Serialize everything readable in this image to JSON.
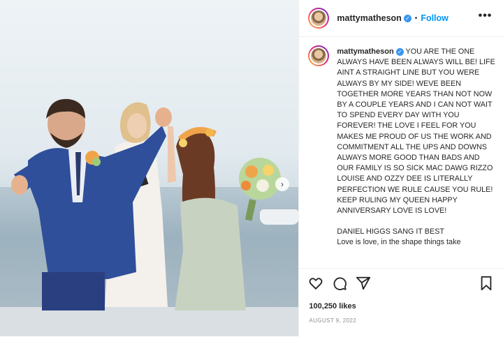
{
  "post": {
    "username": "mattymatheson",
    "follow_label": "Follow",
    "separator": "•",
    "more_label": "•••",
    "caption_paragraphs": [
      "YOU ARE THE ONE ALWAYS HAVE BEEN ALWAYS WILL BE! LIFE AINT A STRAIGHT LINE BUT YOU WERE ALWAYS BY MY SIDE! WEVE BEEN TOGETHER MORE YEARS THAN NOT NOW BY A COUPLE YEARS AND I CAN NOT WAIT TO SPEND EVERY DAY WITH YOU FOREVER! THE LOVE I FEEL FOR YOU MAKES ME PROUD OF US THE WORK AND COMMITMENT ALL THE UPS AND DOWNS ALWAYS MORE GOOD THAN BADS AND OUR FAMILY IS SO SICK MAC DAWG RIZZO LOUISE AND OZZY DEE IS LITERALLY PERFECTION WE RULE CAUSE YOU RULE! KEEP RULING MY QUEEN HAPPY ANNIVERSARY LOVE IS LOVE!",
      "DANIEL HIGGS SANG IT BEST",
      "Love is love, in the shape things take"
    ],
    "likes": "100,250 likes",
    "date": "AUGUST 9, 2022",
    "icons": [
      "heart-icon",
      "comment-icon",
      "share-icon",
      "bookmark-icon",
      "verified-badge-icon",
      "chevron-right-icon"
    ],
    "colors": {
      "link": "#0095f6",
      "verified": "#3897f0",
      "suit": "#2f4f9a"
    }
  }
}
